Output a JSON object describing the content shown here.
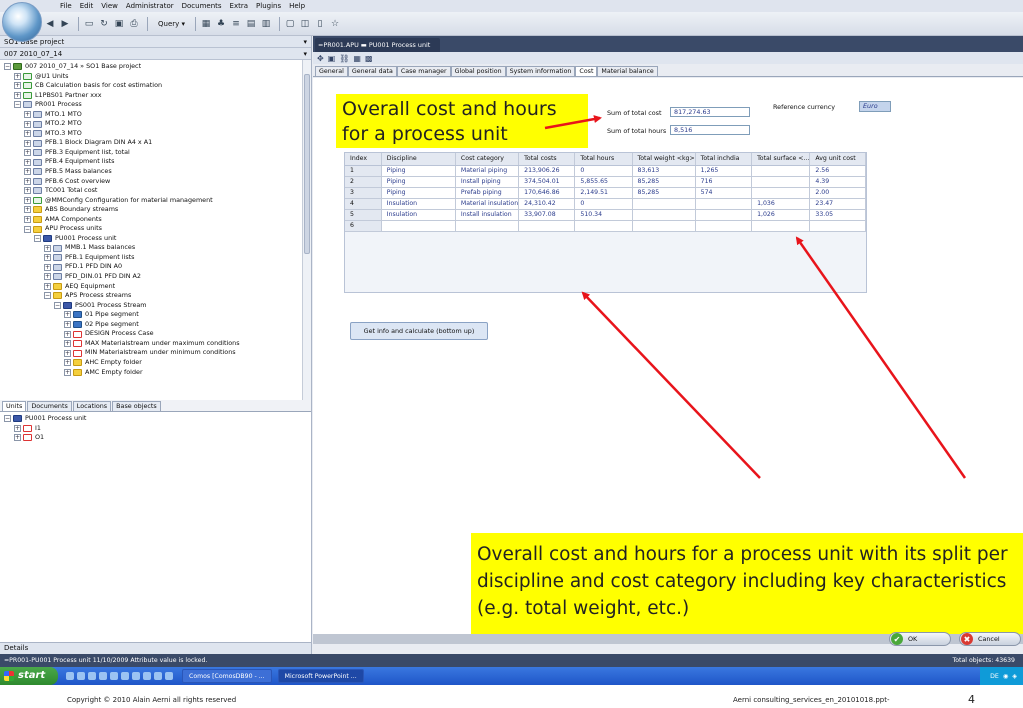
{
  "menu": [
    "File",
    "Edit",
    "View",
    "Administrator",
    "Documents",
    "Extra",
    "Plugins",
    "Help"
  ],
  "toolbar": {
    "query_label": "Query ▾"
  },
  "left": {
    "project": "SO1  Base project",
    "version": "007  2010_07_14",
    "tree": [
      {
        "level": 0,
        "exp": "⊟",
        "icon": "ic-globe",
        "text": "007  2010_07_14  »  SO1   Base project"
      },
      {
        "level": 1,
        "exp": "⊞",
        "icon": "ic-x",
        "text": "@U1   Units"
      },
      {
        "level": 1,
        "exp": "⊞",
        "icon": "ic-x",
        "text": "CB   Calculation basis for cost estimation"
      },
      {
        "level": 1,
        "exp": "⊞",
        "icon": "ic-x",
        "text": "L1PBS01   Partner xxx"
      },
      {
        "level": 1,
        "exp": "⊟",
        "icon": "ic-doc",
        "text": "PR001   Process"
      },
      {
        "level": 2,
        "exp": "⊞",
        "icon": "ic-doc",
        "text": "MTO.1   MTO"
      },
      {
        "level": 2,
        "exp": "⊞",
        "icon": "ic-doc",
        "text": "MTO.2   MTO"
      },
      {
        "level": 2,
        "exp": "⊞",
        "icon": "ic-doc",
        "text": "MTO.3   MTO"
      },
      {
        "level": 2,
        "exp": "⊞",
        "icon": "ic-doc",
        "text": "PFB.1   Block Diagram DIN A4 x A1"
      },
      {
        "level": 2,
        "exp": "⊞",
        "icon": "ic-doc",
        "text": "PFB.3   Equipment list, total"
      },
      {
        "level": 2,
        "exp": "⊞",
        "icon": "ic-doc",
        "text": "PFB.4   Equipment lists"
      },
      {
        "level": 2,
        "exp": "⊞",
        "icon": "ic-doc",
        "text": "PFB.5   Mass balances"
      },
      {
        "level": 2,
        "exp": "⊞",
        "icon": "ic-doc",
        "text": "PFB.6   Cost overview"
      },
      {
        "level": 2,
        "exp": "⊞",
        "icon": "ic-doc",
        "text": "TC001   Total cost"
      },
      {
        "level": 2,
        "exp": "⊞",
        "icon": "ic-x",
        "text": "@MMConfig   Configuration for material management"
      },
      {
        "level": 2,
        "exp": "⊞",
        "icon": "ic-folder",
        "text": "ABS   Boundary streams"
      },
      {
        "level": 2,
        "exp": "⊞",
        "icon": "ic-folder",
        "text": "AMA   Components"
      },
      {
        "level": 2,
        "exp": "⊟",
        "icon": "ic-folder",
        "text": "APU   Process units"
      },
      {
        "level": 3,
        "exp": "⊟",
        "icon": "ic-unit",
        "text": "PU001   Process unit"
      },
      {
        "level": 4,
        "exp": "⊞",
        "icon": "ic-doc",
        "text": "MMB.1   Mass balances"
      },
      {
        "level": 4,
        "exp": "⊞",
        "icon": "ic-doc",
        "text": "PFB.1   Equipment lists"
      },
      {
        "level": 4,
        "exp": "⊞",
        "icon": "ic-doc",
        "text": "PFD.1   PFD DIN A0"
      },
      {
        "level": 4,
        "exp": "⊞",
        "icon": "ic-doc",
        "text": "PFD_DIN.01   PFD DIN A2"
      },
      {
        "level": 4,
        "exp": "⊞",
        "icon": "ic-folder",
        "text": "AEQ   Equipment"
      },
      {
        "level": 4,
        "exp": "⊟",
        "icon": "ic-folder",
        "text": "APS   Process streams"
      },
      {
        "level": 5,
        "exp": "⊟",
        "icon": "ic-unit",
        "text": "PS001   Process Stream"
      },
      {
        "level": 6,
        "exp": "⊞",
        "icon": "ic-pipe",
        "text": "01   Pipe segment"
      },
      {
        "level": 6,
        "exp": "⊞",
        "icon": "ic-pipe",
        "text": "02   Pipe segment"
      },
      {
        "level": 6,
        "exp": "⊞",
        "icon": "ic-red",
        "text": "DESIGN   Process Case"
      },
      {
        "level": 6,
        "exp": "⊞",
        "icon": "ic-red",
        "text": "MAX   Materialstream under maximum conditions"
      },
      {
        "level": 6,
        "exp": "⊞",
        "icon": "ic-red",
        "text": "MIN   Materialstream under minimum conditions"
      },
      {
        "level": 6,
        "exp": "⊞",
        "icon": "ic-folder",
        "text": "AHC   Empty folder"
      },
      {
        "level": 6,
        "exp": "⊞",
        "icon": "ic-folder",
        "text": "AMC   Empty folder"
      }
    ],
    "tabs": [
      "Units",
      "Documents",
      "Locations",
      "Base objects"
    ],
    "lower_tree": [
      {
        "level": 0,
        "exp": "⊟",
        "icon": "ic-unit",
        "text": "PU001   Process unit"
      },
      {
        "level": 1,
        "exp": "⊞",
        "icon": "ic-red",
        "text": "I1"
      },
      {
        "level": 1,
        "exp": "⊞",
        "icon": "ic-red",
        "text": "O1"
      }
    ],
    "details_label": "Details"
  },
  "right": {
    "doc_tab": "=PR001.APU  ▬ PU001   Process unit",
    "tabs": [
      "General",
      "General data",
      "Case manager",
      "Global position",
      "System information",
      "Cost",
      "Material balance"
    ],
    "active_tab": "Cost",
    "callout1": "Overall cost and hours for a process unit",
    "callout2": "Overall cost and hours for a process unit with its split per discipline and cost category  including key characteristics (e.g. total weight, etc.)",
    "sum_cost_label": "Sum of total cost",
    "sum_cost_value": "817,274.63",
    "sum_hours_label": "Sum of total hours",
    "sum_hours_value": "8,516",
    "ref_currency_label": "Reference currency",
    "ref_currency_value": "Euro",
    "grid": {
      "headers": [
        "Index",
        "Discipline",
        "Cost category",
        "Total costs",
        "Total hours",
        "Total weight <kg>",
        "Total inchdia",
        "Total surface <...",
        "Avg unit cost"
      ],
      "rows": [
        [
          "1",
          "Piping",
          "Material piping",
          "213,906.26",
          "0",
          "83,613",
          "1,265",
          "",
          "2.56"
        ],
        [
          "2",
          "Piping",
          "Install piping",
          "374,504.01",
          "5,855.65",
          "85,285",
          "716",
          "",
          "4.39"
        ],
        [
          "3",
          "Piping",
          "Prefab piping",
          "170,646.86",
          "2,149.51",
          "85,285",
          "574",
          "",
          "2.00"
        ],
        [
          "4",
          "Insulation",
          "Material insulation",
          "24,310.42",
          "0",
          "",
          "",
          "1,036",
          "23.47"
        ],
        [
          "5",
          "Insulation",
          "Install insulation",
          "33,907.08",
          "510.34",
          "",
          "",
          "1,026",
          "33.05"
        ],
        [
          "6",
          "",
          "",
          "",
          "",
          "",
          "",
          "",
          ""
        ]
      ]
    },
    "calc_button": "Get info and calculate (bottom up)",
    "ok_label": "OK",
    "cancel_label": "Cancel"
  },
  "status": {
    "left": "=PR001-PU001   Process unit   11/10/2009   Attribute value is locked.",
    "right": "Total objects: 43639"
  },
  "taskbar": {
    "start": "start",
    "tasks": [
      "Comos [ComosDB90 - ...",
      "Microsoft PowerPoint ..."
    ],
    "tray_lang": "DE"
  },
  "footer": {
    "copyright": "Copyright  © 2010 Alain Aerni      all rights reserved",
    "file": "Aerni consulting_services_en_20101018.ppt-",
    "page": "4"
  },
  "colors": {
    "callout": "#ffff00",
    "arrow": "#e8141b",
    "header_dark": "#3a4a68",
    "value_text": "#2a3b8c"
  }
}
